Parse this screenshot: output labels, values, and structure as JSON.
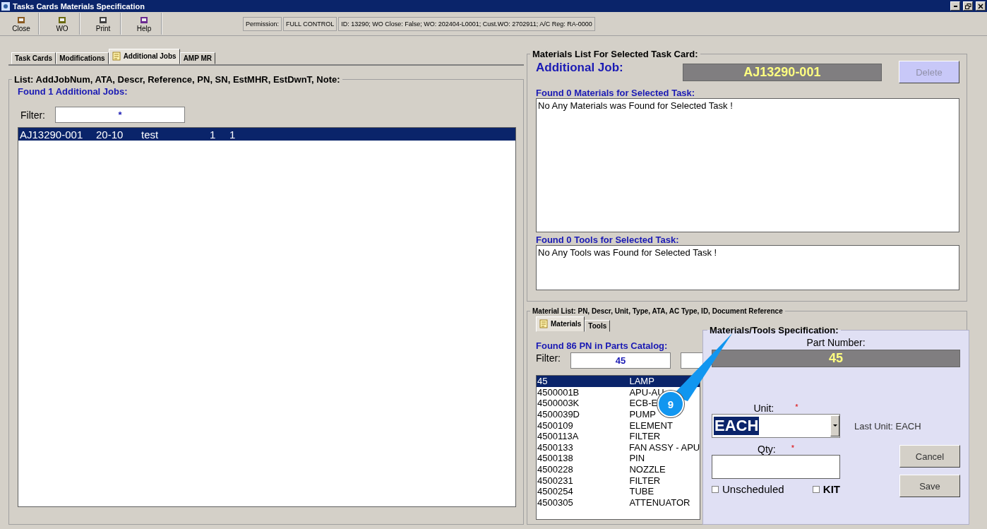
{
  "window": {
    "title": "Tasks Cards Materials Specification"
  },
  "toolbar": {
    "buttons": [
      {
        "label": "Close",
        "kind": "close"
      },
      {
        "label": "WO",
        "kind": "wo"
      },
      {
        "label": "Print",
        "kind": "print"
      },
      {
        "label": "Help",
        "kind": "help"
      }
    ],
    "permission_label": "Permission:",
    "permission_value": "FULL CONTROL",
    "info": "ID: 13290; WO Close: False; WO: 202404-L0001; Cust.WO: 2702911; A/C Reg: RA-0000"
  },
  "left_tabs": [
    {
      "label": "Task Cards",
      "selected": false,
      "has_icon": false
    },
    {
      "label": "Modifications",
      "selected": false,
      "has_icon": false
    },
    {
      "label": "Additional Jobs",
      "selected": true,
      "has_icon": true
    },
    {
      "label": "AMP MR",
      "selected": false,
      "has_icon": false
    }
  ],
  "jobs_panel": {
    "legend": "List: AddJobNum, ATA, Descr, Reference, PN, SN, EstMHR, EstDwnT, Note:",
    "found": "Found 1 Additional Jobs:",
    "filter_label": "Filter:",
    "filter_value": "*",
    "rows": [
      {
        "cells": [
          "AJ13290-001",
          "20-10",
          "test",
          "1",
          "1"
        ],
        "selected": true
      }
    ]
  },
  "materials_panel": {
    "legend": "Materials List For Selected Task Card:",
    "job_label": "Additional Job:",
    "job_value": "AJ13290-001",
    "delete_button": {
      "label": "Delete",
      "disabled": true
    },
    "materials_found": "Found 0 Materials for Selected Task:",
    "materials_message": "No Any Materials was Found for Selected Task !",
    "tools_found": "Found 0 Tools for Selected Task:",
    "tools_message": "No Any Tools was Found for Selected Task !"
  },
  "catalog": {
    "legend": "Material List: PN, Descr, Unit, Type, ATA, AC Type, ID, Document Reference",
    "tabs": [
      {
        "label": "Materials",
        "selected": true,
        "has_icon": true
      },
      {
        "label": "Tools",
        "selected": false,
        "has_icon": false
      }
    ],
    "found": "Found 86 PN in Parts Catalog:",
    "filter_label": "Filter:",
    "filter_value": "45",
    "rows": [
      {
        "pn": "45",
        "descr": "LAMP",
        "selected": true
      },
      {
        "pn": "4500001B",
        "descr": "APU-AU",
        "selected": false
      },
      {
        "pn": "4500003K",
        "descr": "ECB-E",
        "selected": false
      },
      {
        "pn": "4500039D",
        "descr": "PUMP",
        "selected": false
      },
      {
        "pn": "4500109",
        "descr": "ELEMENT",
        "selected": false
      },
      {
        "pn": "4500113A",
        "descr": "FILTER",
        "selected": false
      },
      {
        "pn": "4500133",
        "descr": "FAN ASSY - APU",
        "selected": false
      },
      {
        "pn": "4500138",
        "descr": "PIN",
        "selected": false
      },
      {
        "pn": "4500228",
        "descr": "NOZZLE",
        "selected": false
      },
      {
        "pn": "4500231",
        "descr": "FILTER",
        "selected": false
      },
      {
        "pn": "4500254",
        "descr": "TUBE",
        "selected": false
      },
      {
        "pn": "4500305",
        "descr": "ATTENUATOR",
        "selected": false
      }
    ]
  },
  "spec": {
    "legend": "Materials/Tools Specification:",
    "part_number_label": "Part Number:",
    "part_number_value": "45",
    "unit_label": "Unit:",
    "unit_required": "*",
    "unit_value": "EACH",
    "last_unit": "Last Unit: EACH",
    "qty_label": "Qty:",
    "qty_required": "*",
    "checkboxes": [
      {
        "label": "Unscheduled",
        "checked": false
      },
      {
        "label": "KIT",
        "checked": false
      }
    ],
    "buttons": [
      "Cancel",
      "Save"
    ]
  },
  "callout": {
    "number": "9"
  }
}
